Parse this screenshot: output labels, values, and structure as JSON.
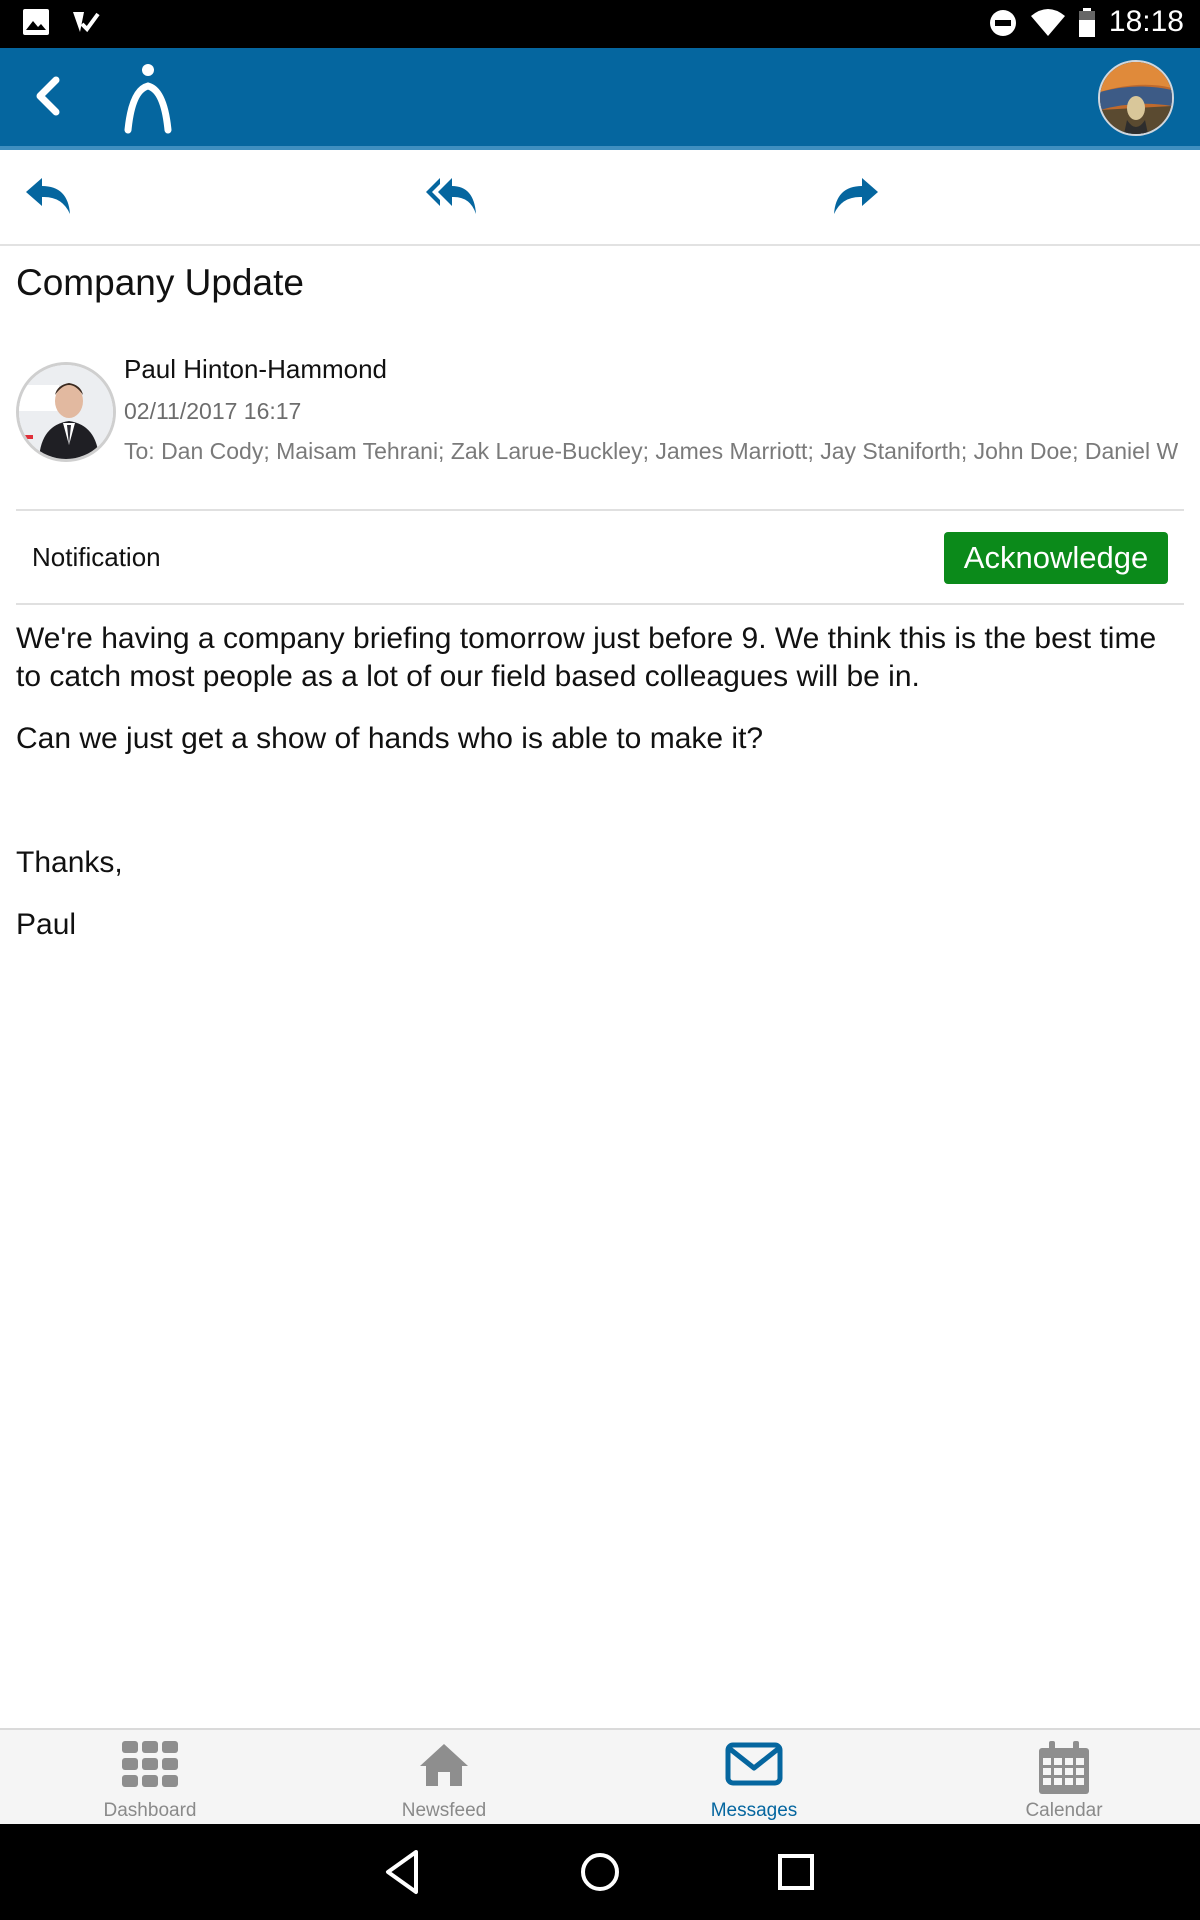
{
  "status_bar": {
    "time": "18:18"
  },
  "message": {
    "subject": "Company Update",
    "sender": "Paul Hinton-Hammond",
    "date": "02/11/2017 16:17",
    "recipients": "To: Dan Cody; Maisam Tehrani; Zak Larue-Buckley; James Marriott; Jay Staniforth; John Doe; Daniel W",
    "notification_label": "Notification",
    "acknowledge_label": "Acknowledge",
    "body": [
      "We're having a company briefing tomorrow just before 9. We think this is the best time to catch most people as a lot of our field based colleagues will be in.",
      "Can we just get a show of hands who is able to make it?",
      "Thanks,",
      "Paul"
    ]
  },
  "tabs": [
    {
      "label": "Dashboard",
      "icon": "dashboard-grid-icon"
    },
    {
      "label": "Newsfeed",
      "icon": "home-icon"
    },
    {
      "label": "Messages",
      "icon": "envelope-icon",
      "active": true
    },
    {
      "label": "Calendar",
      "icon": "calendar-icon"
    }
  ],
  "colors": {
    "app_bar": "#05669f",
    "acknowledge": "#0b8a1a",
    "active_tab": "#05669f"
  }
}
